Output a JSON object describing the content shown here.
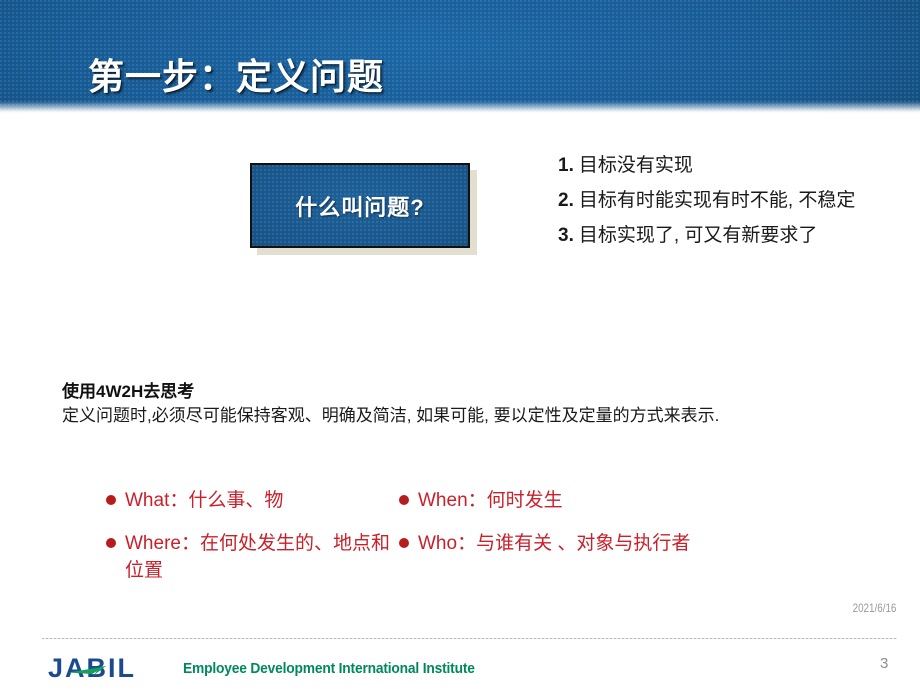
{
  "slide": {
    "title": "第一步：定义问题",
    "page_number": "3",
    "date_stamp": "2021/6/16"
  },
  "question_box": {
    "label": "什么叫问题?"
  },
  "definition_list": {
    "items": [
      {
        "marker": "1.",
        "text": "目标没有实现"
      },
      {
        "marker": "2.",
        "text": "目标有时能实现有时不能, 不稳定"
      },
      {
        "marker": "3.",
        "text": "目标实现了, 可又有新要求了"
      }
    ]
  },
  "method_section": {
    "heading": "使用4W2H去思考",
    "body": "定义问题时,必须尽可能保持客观、明确及简洁, 如果可能, 要以定性及定量的方式来表示."
  },
  "bullets": {
    "rows": [
      {
        "left": {
          "keyword": "What",
          "separator": "：",
          "description": "什么事、物"
        },
        "right": {
          "keyword": "When",
          "separator": "：",
          "description": "何时发生"
        }
      },
      {
        "left": {
          "keyword": "Where",
          "separator": "：",
          "description": "在何处发生的、地点和位置"
        },
        "right": {
          "keyword": "Who",
          "separator": "：",
          "description": "与谁有关 、对象与执行者"
        }
      }
    ],
    "dot_color": "#b71c1c",
    "text_color": "#c9202a"
  },
  "footer": {
    "logo_text": "JABIL",
    "tagline": "Employee Development International Institute",
    "logo_color": "#1b4a8f",
    "accent_color": "#00885c"
  }
}
